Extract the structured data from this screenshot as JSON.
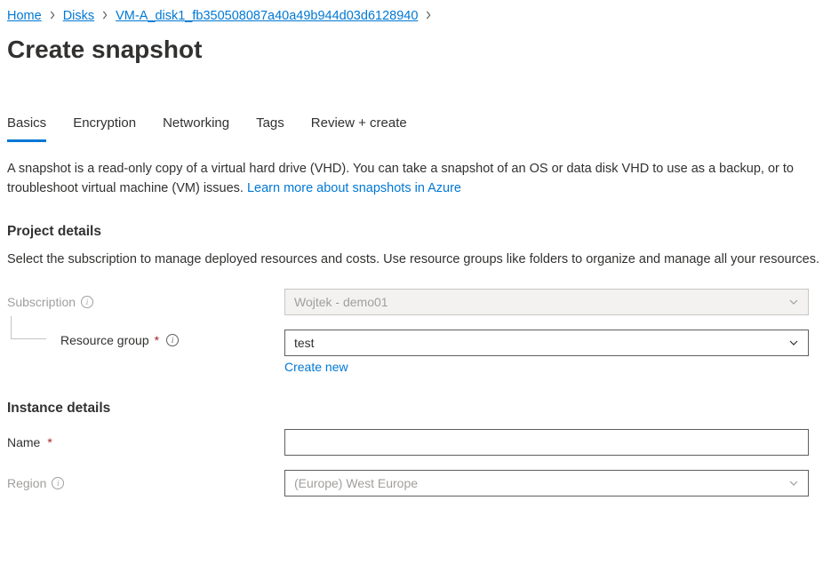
{
  "breadcrumb": {
    "items": [
      "Home",
      "Disks",
      "VM-A_disk1_fb350508087a40a49b944d03d6128940"
    ]
  },
  "page_title": "Create snapshot",
  "tabs": [
    "Basics",
    "Encryption",
    "Networking",
    "Tags",
    "Review + create"
  ],
  "description": {
    "text": "A snapshot is a read-only copy of a virtual hard drive (VHD). You can take a snapshot of an OS or data disk VHD to use as a backup, or to troubleshoot virtual machine (VM) issues.  ",
    "link": "Learn more about snapshots in Azure"
  },
  "sections": {
    "project_details": {
      "title": "Project details",
      "desc": "Select the subscription to manage deployed resources and costs. Use resource groups like folders to organize and manage all your resources."
    },
    "instance_details": {
      "title": "Instance details"
    }
  },
  "fields": {
    "subscription": {
      "label": "Subscription",
      "value": "Wojtek - demo01"
    },
    "resource_group": {
      "label": "Resource group",
      "value": "test",
      "create_new": "Create new"
    },
    "name": {
      "label": "Name",
      "value": ""
    },
    "region": {
      "label": "Region",
      "value": "(Europe) West Europe"
    }
  }
}
